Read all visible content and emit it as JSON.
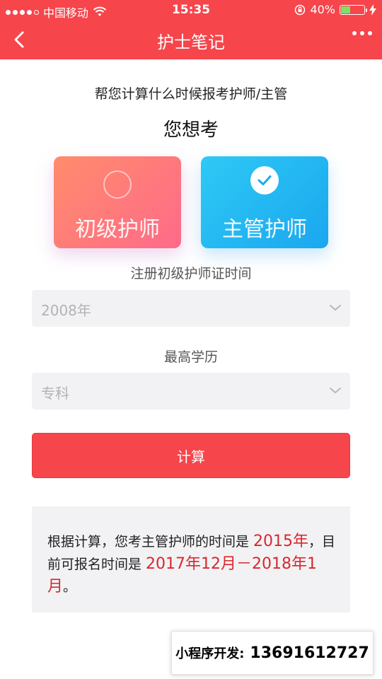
{
  "status_bar": {
    "carrier": "中国移动",
    "time": "15:35",
    "battery_percent": "40%",
    "battery_level": 0.4,
    "icons": [
      "signal-dots-icon",
      "wifi-icon",
      "rotation-lock-icon",
      "battery-icon",
      "charging-icon"
    ]
  },
  "nav": {
    "title": "护士笔记",
    "back_icon": "back-arrow-icon",
    "more_icon": "more-dots-icon"
  },
  "intro": {
    "subtitle": "帮您计算什么时候报考护师/主管",
    "question": "您想考"
  },
  "options": [
    {
      "label": "初级护师",
      "selected": false,
      "color": "#ff7a7a"
    },
    {
      "label": "主管护师",
      "selected": true,
      "color": "#22b6f2"
    }
  ],
  "form": {
    "cert_time_label": "注册初级护师证时间",
    "cert_time_value": "2008年",
    "education_label": "最高学历",
    "education_value": "专科"
  },
  "calculate_button": "计算",
  "result": {
    "part1": "根据计算，您考主管护师的时间是 ",
    "exam_year": "2015年",
    "part2": "，目前可报名时间是 ",
    "registration_period": "2017年12月－2018年1月",
    "part3": "。"
  },
  "watermark": {
    "label": "小程序开发:",
    "phone": "13691612727"
  },
  "colors": {
    "brand_red": "#f6454b",
    "highlight_red": "#d8282c",
    "field_bg": "#f2f2f4"
  }
}
